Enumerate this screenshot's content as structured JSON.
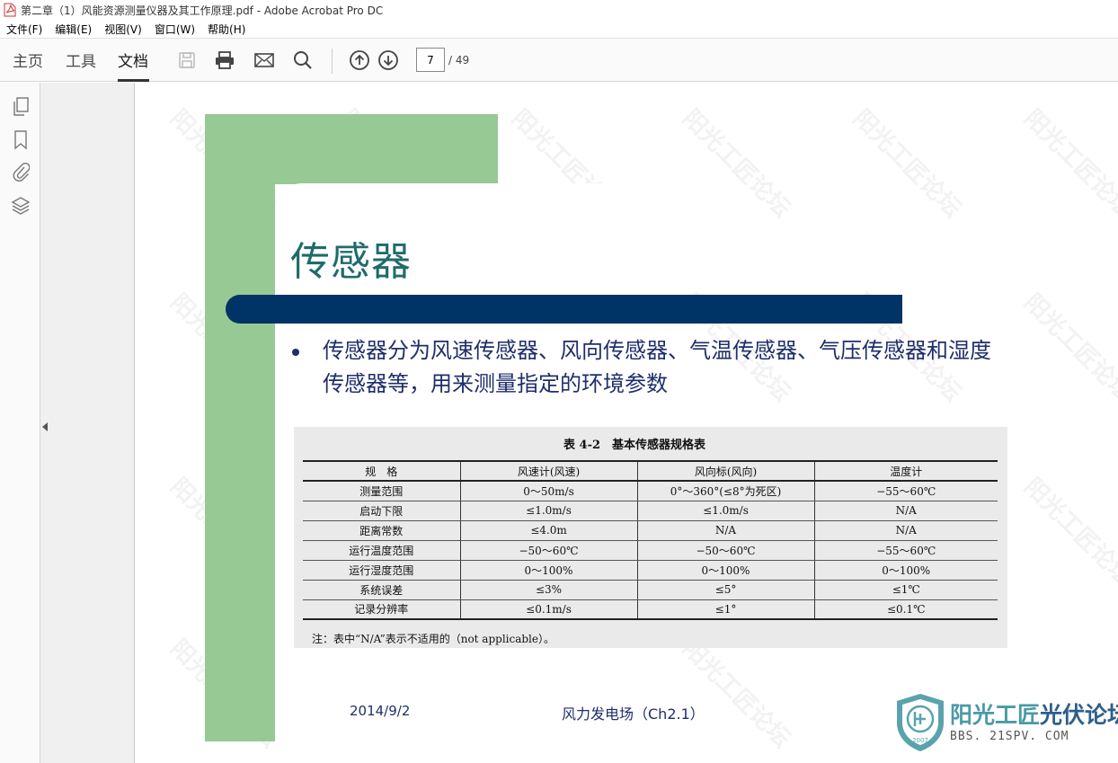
{
  "window": {
    "title": "第二章（1）风能资源测量仪器及其工作原理.pdf - Adobe Acrobat Pro DC"
  },
  "menu": [
    "文件(F)",
    "编辑(E)",
    "视图(V)",
    "窗口(W)",
    "帮助(H)"
  ],
  "tabs": {
    "home": "主页",
    "tools": "工具",
    "document": "文档"
  },
  "pagenav": {
    "current": "7",
    "total": "/ 49"
  },
  "slide": {
    "title": "传感器",
    "bullet": "传感器分为风速传感器、风向传感器、气温传感器、气压传感器和湿度传感器等，用来测量指定的环境参数",
    "table": {
      "caption": "表 4-2　基本传感器规格表",
      "headers": [
        "规　格",
        "风速计(风速)",
        "风向标(风向)",
        "温度计"
      ],
      "rows": [
        [
          "测量范围",
          "0～50m/s",
          "0°～360°(≤8°为死区)",
          "−55～60℃"
        ],
        [
          "启动下限",
          "≤1.0m/s",
          "≤1.0m/s",
          "N/A"
        ],
        [
          "距离常数",
          "≤4.0m",
          "N/A",
          "N/A"
        ],
        [
          "运行温度范围",
          "−50～60℃",
          "−50～60℃",
          "−55～60℃"
        ],
        [
          "运行湿度范围",
          "0～100%",
          "0～100%",
          "0～100%"
        ],
        [
          "系统误差",
          "≤3%",
          "≤5°",
          "≤1℃"
        ],
        [
          "记录分辨率",
          "≤0.1m/s",
          "≤1°",
          "≤0.1℃"
        ]
      ],
      "note": "注：表中“N/A”表示不适用的（not applicable）。"
    },
    "footer_date": "2014/9/2",
    "footer_center": "风力发电场（Ch2.1）"
  },
  "watermark": {
    "text": "阳光工匠论坛"
  },
  "logo": {
    "name_part1": "阳光工匠",
    "name_part2": "光伏论坛",
    "url": "BBS. 21SPV. COM",
    "year": "2007"
  },
  "colors": {
    "green": "#97c994",
    "navy": "#003366",
    "title": "#1f6b6b",
    "text": "#1f2e6b"
  }
}
